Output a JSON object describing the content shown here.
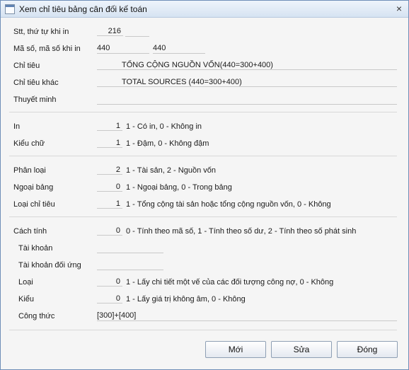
{
  "window": {
    "title": "Xem chỉ tiêu bảng cân đối kế toán",
    "close_glyph": "×"
  },
  "fields": {
    "stt": {
      "label": "Stt, thứ tự khi in",
      "value": "216"
    },
    "ma_so": {
      "label": "Mã số, mã số khi in",
      "value": "440",
      "value2": "440"
    },
    "chi_tieu": {
      "label": "Chỉ tiêu",
      "value": "TỔNG CỘNG NGUỒN VỐN(440=300+400)"
    },
    "chi_tieu_khac": {
      "label": "Chỉ tiêu khác",
      "value": "TOTAL SOURCES (440=300+400)"
    },
    "thuyet_minh": {
      "label": "Thuyết minh",
      "value": ""
    },
    "in": {
      "label": "In",
      "value": "1",
      "note": "1 - Có in, 0 - Không in"
    },
    "kieu_chu": {
      "label": "Kiểu chữ",
      "value": "1",
      "note": "1 - Đậm, 0 - Không đậm"
    },
    "phan_loai": {
      "label": "Phân loại",
      "value": "2",
      "note": "1 - Tài sản, 2 - Nguồn vốn"
    },
    "ngoai_bang": {
      "label": "Ngoại bảng",
      "value": "0",
      "note": "1 - Ngoại bảng, 0 - Trong bảng"
    },
    "loai_chi_tieu": {
      "label": "Loại chỉ tiêu",
      "value": "1",
      "note": "1 - Tổng cộng tài sản hoặc tổng cộng nguồn vốn, 0 - Không"
    },
    "cach_tinh": {
      "label": "Cách tính",
      "value": "0",
      "note": "0 - Tính theo mã số, 1 - Tính theo số dư, 2 - Tính theo số phát sinh"
    },
    "tai_khoan": {
      "label": "Tài khoản",
      "value": ""
    },
    "tai_khoan_doi_ung": {
      "label": "Tài khoản đối ứng",
      "value": ""
    },
    "loai": {
      "label": "Loại",
      "value": "0",
      "note": "1 - Lấy chi tiết một vế của các đối tượng công nợ, 0 - Không"
    },
    "kieu": {
      "label": "Kiểu",
      "value": "0",
      "note": "1 - Lấy giá trị không âm, 0 - Không"
    },
    "cong_thuc": {
      "label": "Công thức",
      "value": "[300]+[400]"
    }
  },
  "buttons": {
    "new": "Mới",
    "edit": "Sửa",
    "close": "Đóng"
  }
}
